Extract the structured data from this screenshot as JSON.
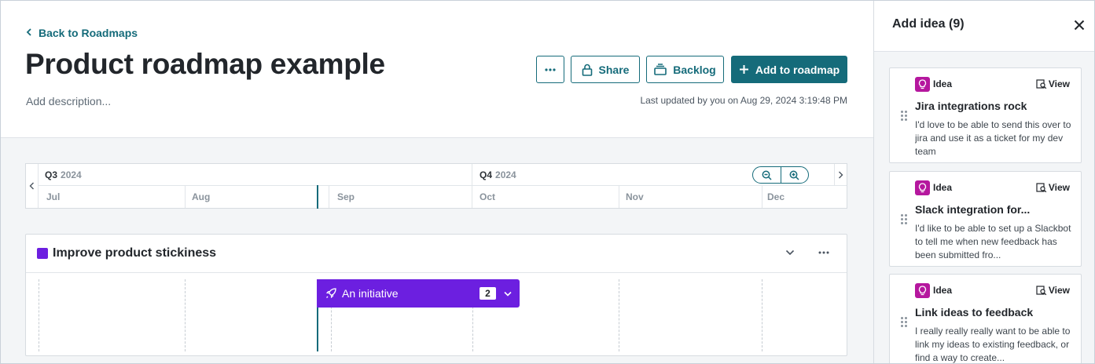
{
  "header": {
    "back_label": "Back to Roadmaps",
    "title": "Product roadmap example",
    "description_placeholder": "Add description...",
    "last_updated": "Last updated by you on Aug 29, 2024 3:19:48 PM",
    "share_label": "Share",
    "backlog_label": "Backlog",
    "add_label": "Add to roadmap"
  },
  "timeline": {
    "quarters": [
      {
        "name": "Q3",
        "year": "2024"
      },
      {
        "name": "Q4",
        "year": "2024"
      }
    ],
    "months": [
      "Jul",
      "Aug",
      "Sep",
      "Oct",
      "Nov",
      "Dec"
    ]
  },
  "goal": {
    "title": "Improve product stickiness",
    "color": "#6c1fe0",
    "initiative": {
      "label": "An initiative",
      "count": "2"
    }
  },
  "panel": {
    "title": "Add idea (9)",
    "cards": [
      {
        "type": "Idea",
        "view_label": "View",
        "title": "Jira integrations rock",
        "body": "I'd love to be able to send this over to jira and use it as a ticket for my dev team"
      },
      {
        "type": "Idea",
        "view_label": "View",
        "title": "Slack integration for...",
        "body": "I'd like to be able to set up a Slackbot to tell me when new feedback has been submitted fro..."
      },
      {
        "type": "Idea",
        "view_label": "View",
        "title": "Link ideas to feedback",
        "body": "I really really really want to be able to link my ideas to existing feedback, or find a way to create..."
      }
    ]
  },
  "colors": {
    "accent": "#156b7a",
    "goal": "#6c1fe0",
    "idea_badge": "#b5179e"
  }
}
